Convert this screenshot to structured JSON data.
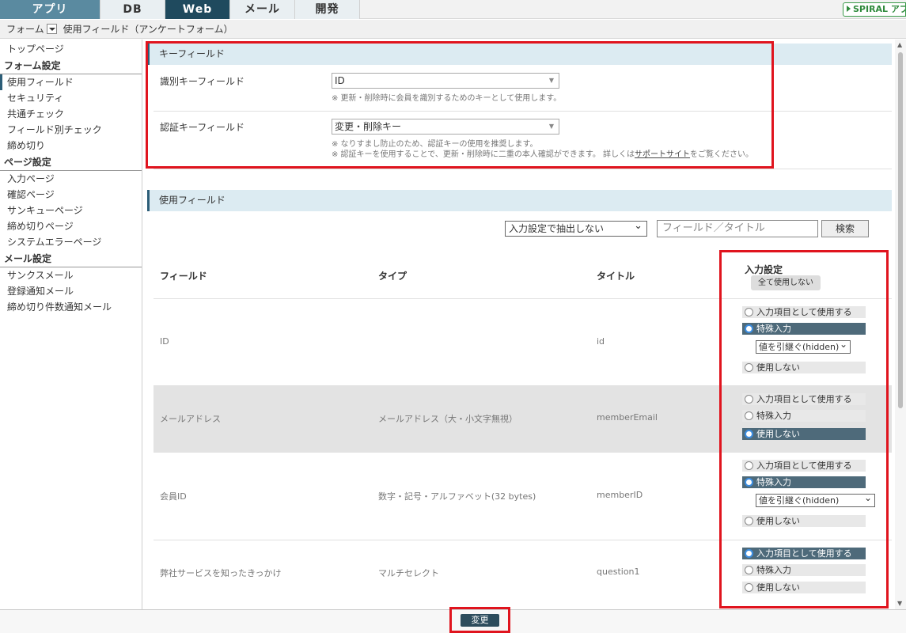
{
  "tabs": [
    {
      "label": "アプリ"
    },
    {
      "label": "DB"
    },
    {
      "label": "Web"
    },
    {
      "label": "メール"
    },
    {
      "label": "開発"
    }
  ],
  "brand": "SPIRAL アプリ",
  "breadcrumb": {
    "root": "フォーム",
    "current": "使用フィールド（アンケートフォーム）"
  },
  "sidebar": {
    "top": "トップページ",
    "form_settings": "フォーム設定",
    "form_items": [
      "使用フィールド",
      "セキュリティ",
      "共通チェック",
      "フィールド別チェック",
      "締め切り"
    ],
    "page_settings": "ページ設定",
    "page_items": [
      "入力ページ",
      "確認ページ",
      "サンキューページ",
      "締め切りページ",
      "システムエラーページ"
    ],
    "mail_settings": "メール設定",
    "mail_items": [
      "サンクスメール",
      "登録通知メール",
      "締め切り件数通知メール"
    ]
  },
  "key_fields": {
    "title": "キーフィールド",
    "id_label": "識別キーフィールド",
    "id_value": "ID",
    "id_note": "※ 更新・削除時に会員を識別するためのキーとして使用します。",
    "auth_label": "認証キーフィールド",
    "auth_value": "変更・削除キー",
    "auth_note1": "※ なりすまし防止のため、認証キーの使用を推奨します。",
    "auth_note2_pre": "※ 認証キーを使用することで、更新・削除時に二重の本人確認ができます。 詳しくは",
    "auth_note2_link": "サポートサイト",
    "auth_note2_post": "をご覧ください。"
  },
  "used_fields": {
    "title": "使用フィールド",
    "filter_value": "入力設定で抽出しない",
    "search_placeholder": "フィールド／タイトル",
    "search_button": "検索",
    "headers": {
      "field": "フィールド",
      "type": "タイプ",
      "title": "タイトル",
      "input": "入力設定"
    },
    "all_unused_button": "全て使用しない",
    "options": {
      "input": "入力項目として使用する",
      "special": "特殊入力",
      "unused": "使用しない"
    },
    "rows": [
      {
        "field": "ID",
        "type": "",
        "title": "id",
        "selected": "special",
        "sub": "値を引継ぐ(hidden)"
      },
      {
        "field": "メールアドレス",
        "type": "メールアドレス（大・小文字無視）",
        "title": "memberEmail",
        "selected": "unused"
      },
      {
        "field": "会員ID",
        "type": "数字・記号・アルファベット(32 bytes)",
        "title": "memberID",
        "selected": "special",
        "sub": "値を引継ぐ(hidden)"
      },
      {
        "field": "弊社サービスを知ったきっかけ",
        "type": "マルチセレクト",
        "title": "question1",
        "selected": "input"
      }
    ]
  },
  "submit_button": "変更"
}
